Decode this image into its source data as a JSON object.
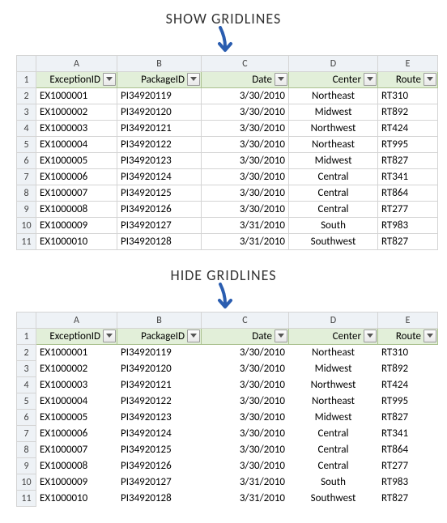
{
  "titles": {
    "show": "SHOW GRIDLINES",
    "hide": "HIDE GRIDLINES"
  },
  "columns": {
    "letters": [
      "A",
      "B",
      "C",
      "D",
      "E"
    ],
    "headers": [
      "ExceptionID",
      "PackageID",
      "Date",
      "Center",
      "Route"
    ]
  },
  "row_numbers": [
    "1",
    "2",
    "3",
    "4",
    "5",
    "6",
    "7",
    "8",
    "9",
    "10",
    "11"
  ],
  "rows": [
    {
      "exception_id": "EX1000001",
      "package_id": "PI34920119",
      "date": "3/30/2010",
      "center": "Northeast",
      "route": "RT310"
    },
    {
      "exception_id": "EX1000002",
      "package_id": "PI34920120",
      "date": "3/30/2010",
      "center": "Midwest",
      "route": "RT892"
    },
    {
      "exception_id": "EX1000003",
      "package_id": "PI34920121",
      "date": "3/30/2010",
      "center": "Northwest",
      "route": "RT424"
    },
    {
      "exception_id": "EX1000004",
      "package_id": "PI34920122",
      "date": "3/30/2010",
      "center": "Northeast",
      "route": "RT995"
    },
    {
      "exception_id": "EX1000005",
      "package_id": "PI34920123",
      "date": "3/30/2010",
      "center": "Midwest",
      "route": "RT827"
    },
    {
      "exception_id": "EX1000006",
      "package_id": "PI34920124",
      "date": "3/30/2010",
      "center": "Central",
      "route": "RT341"
    },
    {
      "exception_id": "EX1000007",
      "package_id": "PI34920125",
      "date": "3/30/2010",
      "center": "Central",
      "route": "RT864"
    },
    {
      "exception_id": "EX1000008",
      "package_id": "PI34920126",
      "date": "3/30/2010",
      "center": "Central",
      "route": "RT277"
    },
    {
      "exception_id": "EX1000009",
      "package_id": "PI34920127",
      "date": "3/31/2010",
      "center": "South",
      "route": "RT983"
    },
    {
      "exception_id": "EX1000010",
      "package_id": "PI34920128",
      "date": "3/31/2010",
      "center": "Southwest",
      "route": "RT827"
    }
  ]
}
